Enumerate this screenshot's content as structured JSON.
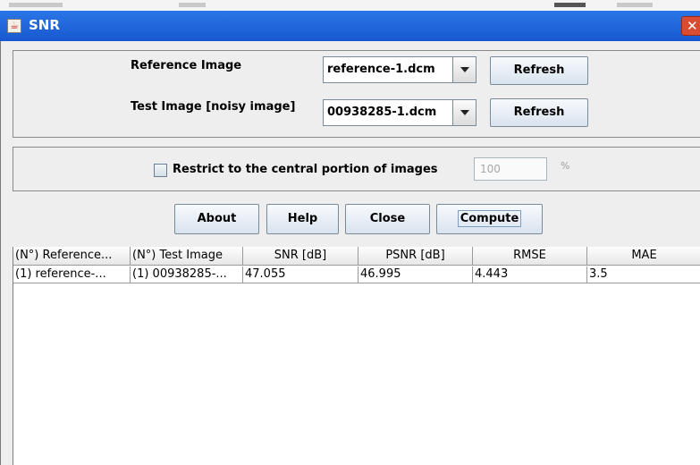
{
  "window": {
    "title": "SNR",
    "app_icon": "java-cup-icon",
    "close_icon": "close-icon"
  },
  "reference": {
    "label": "Reference Image",
    "selected": "reference-1.dcm",
    "refresh_label": "Refresh"
  },
  "test": {
    "label": "Test Image [noisy image]",
    "selected": "00938285-1.dcm",
    "refresh_label": "Refresh"
  },
  "restrict": {
    "label": "Restrict to the central portion of images",
    "checked": false,
    "value": "100",
    "unit": "%"
  },
  "actions": {
    "about": "About",
    "help": "Help",
    "close": "Close",
    "compute": "Compute"
  },
  "table": {
    "headers": [
      "(N°) Reference...",
      "(N°) Test Image",
      "SNR [dB]",
      "PSNR [dB]",
      "RMSE",
      "MAE"
    ],
    "rows": [
      [
        "(1) reference-...",
        "(1) 00938285-...",
        "47.055",
        "46.995",
        "4.443",
        "3.5"
      ]
    ]
  },
  "colors": {
    "titlebar": "#1e63da",
    "panel": "#eeeeee",
    "close_button": "#d94b32"
  }
}
